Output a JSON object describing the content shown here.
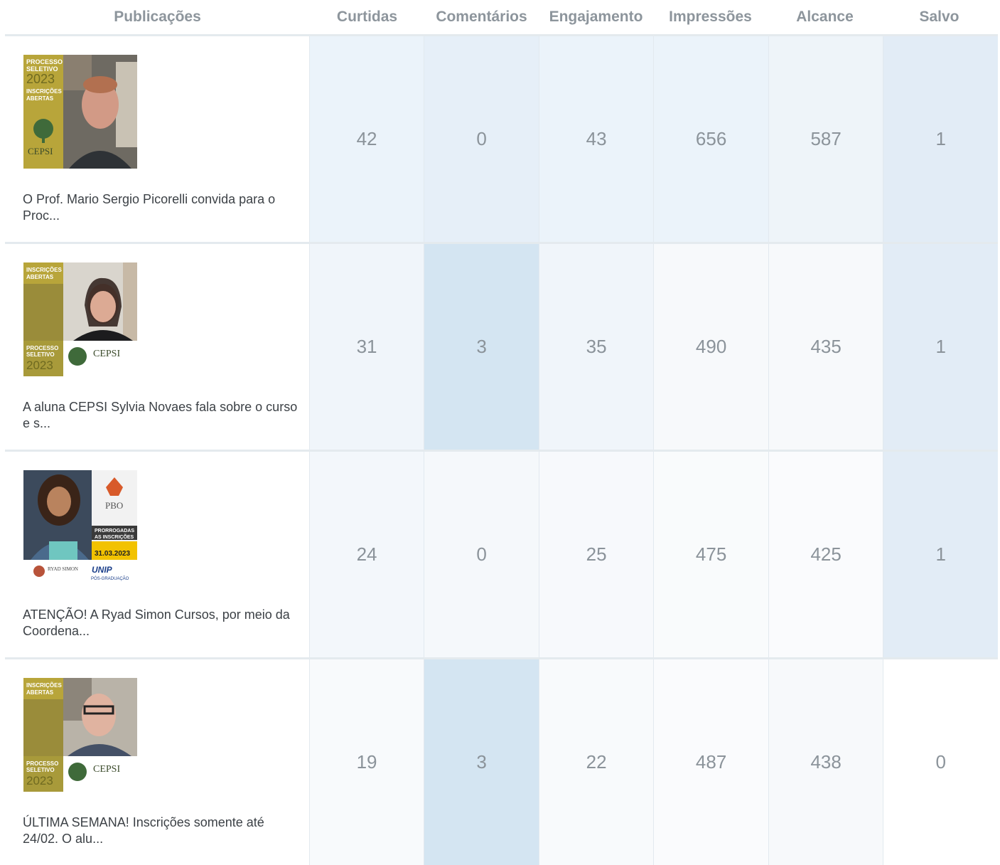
{
  "columns": {
    "publicacoes": "Publicações",
    "curtidas": "Curtidas",
    "comentarios": "Comentários",
    "engajamento": "Engajamento",
    "impressoes": "Impressões",
    "alcance": "Alcance",
    "salvo": "Salvo"
  },
  "rows": [
    {
      "caption": "O Prof. Mario Sergio Picorelli convida para o Proc...",
      "thumb": {
        "top_line1": "PROCESSO",
        "top_line2": "SELETIVO",
        "year": "2023",
        "line3": "INSCRIÇÕES",
        "line4": "ABERTAS",
        "brand": "CEPSI"
      },
      "curtidas": "42",
      "comentarios": "0",
      "engajamento": "43",
      "impressoes": "656",
      "alcance": "587",
      "salvo": "1",
      "shades": [
        "#ebf3fa",
        "#e6eff8",
        "#ebf3fa",
        "#ebf3fa",
        "#eef4f9",
        "#e2ecf6"
      ]
    },
    {
      "caption": "A aluna CEPSI Sylvia Novaes fala sobre o curso e s...",
      "thumb": {
        "top_line1": "INSCRIÇÕES",
        "top_line2": "ABERTAS",
        "year": "2023",
        "line3": "PROCESSO",
        "line4": "SELETIVO",
        "brand": "CEPSI"
      },
      "curtidas": "31",
      "comentarios": "3",
      "engajamento": "35",
      "impressoes": "490",
      "alcance": "435",
      "salvo": "1",
      "shades": [
        "#f0f5fa",
        "#d4e5f2",
        "#f0f5fa",
        "#f7f9fb",
        "#f7f9fb",
        "#e2ecf6"
      ]
    },
    {
      "caption": "ATENÇÃO! A Ryad Simon Cursos, por meio da Coordena...",
      "thumb": {
        "brand": "PBO",
        "banner1": "PRORROGADAS",
        "banner2": "AS INSCRIÇÕES",
        "date": "31.03.2023",
        "logo1": "RYAD SIMON",
        "logo2": "UNIP",
        "logo3": "PÓS-GRADUAÇÃO"
      },
      "curtidas": "24",
      "comentarios": "0",
      "engajamento": "25",
      "impressoes": "475",
      "alcance": "425",
      "salvo": "1",
      "shades": [
        "#f3f7fb",
        "#f5f8fb",
        "#f7f9fc",
        "#f9fbfc",
        "#fafbfd",
        "#e2ecf6"
      ]
    },
    {
      "caption": "ÚLTIMA SEMANA! Inscrições somente até 24/02. O alu...",
      "thumb": {
        "top_line1": "INSCRIÇÕES",
        "top_line2": "ABERTAS",
        "year": "2023",
        "line3": "PROCESSO",
        "line4": "SELETIVO",
        "brand": "CEPSI"
      },
      "curtidas": "19",
      "comentarios": "3",
      "engajamento": "22",
      "impressoes": "487",
      "alcance": "438",
      "salvo": "0",
      "shades": [
        "#f8fafc",
        "#d4e5f2",
        "#f8fafc",
        "#fafbfd",
        "#f7f9fb",
        "#ffffff"
      ]
    }
  ]
}
